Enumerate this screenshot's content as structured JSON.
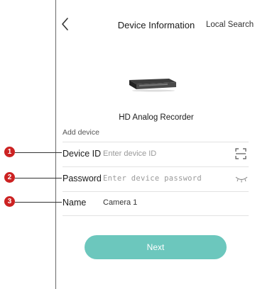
{
  "header": {
    "title": "Device Information",
    "local_search_label": "Local Search"
  },
  "device": {
    "name": "HD Analog Recorder"
  },
  "form": {
    "section_label": "Add device",
    "device_id": {
      "label": "Device ID",
      "value": "",
      "placeholder": "Enter device ID"
    },
    "password": {
      "label": "Password",
      "value": "",
      "placeholder": "Enter device password"
    },
    "name": {
      "label": "Name",
      "value": "Camera 1",
      "placeholder": ""
    }
  },
  "callouts": [
    "1",
    "2",
    "3"
  ],
  "next_button_label": "Next",
  "colors": {
    "accent": "#6cc7bd",
    "callout": "#cc2222"
  },
  "icons": {
    "back": "chevron-left-icon",
    "scan": "scan-icon",
    "eye": "eye-closed-icon"
  }
}
